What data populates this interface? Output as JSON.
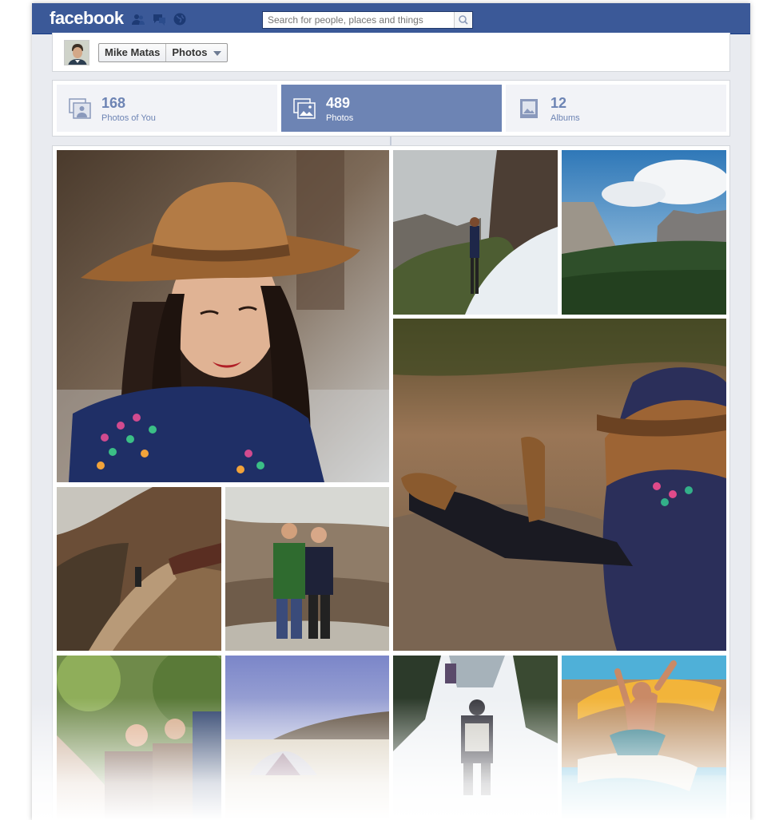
{
  "header": {
    "logo": "facebook",
    "search_placeholder": "Search for people, places and things"
  },
  "profile": {
    "name": "Mike Matas",
    "section": "Photos"
  },
  "tabs": [
    {
      "count": "168",
      "label": "Photos of You",
      "icon": "photos-of-you-icon",
      "active": false
    },
    {
      "count": "489",
      "label": "Photos",
      "icon": "photos-icon",
      "active": true
    },
    {
      "count": "12",
      "label": "Albums",
      "icon": "albums-icon",
      "active": false
    }
  ],
  "colors": {
    "brand_blue": "#3b5998",
    "tab_active": "#6d84b4",
    "tab_inactive": "#f2f3f7"
  },
  "photos": [
    "woman-in-hat-portrait",
    "hiker-on-snowy-cliff",
    "yosemite-valley",
    "sitting-woman-on-rock",
    "cliff-trail",
    "couple-on-summit",
    "friends-laughing",
    "tent-on-beach",
    "snowy-trail-hiker",
    "man-jumping-by-pool"
  ]
}
